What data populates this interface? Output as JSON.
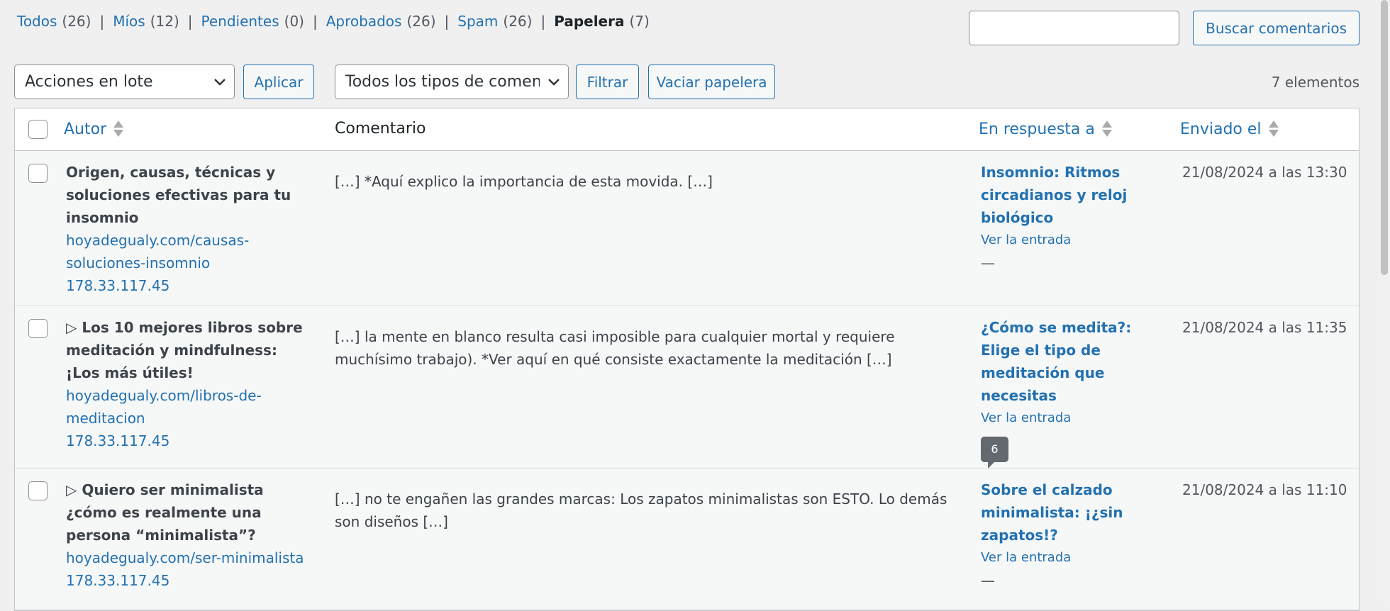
{
  "filters": [
    {
      "label": "Todos",
      "count": "(26)"
    },
    {
      "label": "Míos",
      "count": "(12)"
    },
    {
      "label": "Pendientes",
      "count": "(0)"
    },
    {
      "label": "Aprobados",
      "count": "(26)"
    },
    {
      "label": "Spam",
      "count": "(26)"
    },
    {
      "label": "Papelera",
      "count": "(7)"
    }
  ],
  "separator": "|",
  "search": {
    "value": "",
    "button": "Buscar comentarios"
  },
  "tablenav": {
    "bulk_actions": "Acciones en lote",
    "apply": "Aplicar",
    "comment_type": "Todos los tipos de comentarios",
    "filter": "Filtrar",
    "empty_trash": "Vaciar papelera",
    "count": "7 elementos"
  },
  "columns": {
    "author": "Autor",
    "comment": "Comentario",
    "response": "En respuesta a",
    "date": "Enviado el"
  },
  "rows": [
    {
      "author_name": "Origen, causas, técnicas y soluciones efectivas para tu insomnio",
      "author_url": "hoyadegualy.com/causas-soluciones-insomnio",
      "author_ip": "178.33.117.45",
      "comment": "[…] *Aquí explico la importancia de esta movida. […]",
      "response_post": "Insomnio: Ritmos circadianos y reloj biológico",
      "view": "Ver la entrada",
      "count": "—",
      "date": "21/08/2024 a las 13:30"
    },
    {
      "author_name": "▷ Los 10 mejores libros sobre meditación y mindfulness: ¡Los más útiles!",
      "author_url": "hoyadegualy.com/libros-de-meditacion",
      "author_ip": "178.33.117.45",
      "comment": "[…] la mente en blanco resulta casi imposible para cualquier mortal y requiere muchísimo trabajo). *Ver aquí en qué consiste exactamente la meditación […]",
      "response_post": "¿Cómo se medita?: Elige el tipo de meditación que necesitas",
      "view": "Ver la entrada",
      "count": "6",
      "date": "21/08/2024 a las 11:35"
    },
    {
      "author_name": "▷ Quiero ser minimalista ¿cómo es realmente una persona “minimalista”?",
      "author_url": "hoyadegualy.com/ser-minimalista",
      "author_ip": "178.33.117.45",
      "comment": "[…] no te engañen las grandes marcas: Los zapatos minimalistas son ESTO. Lo demás son diseños […]",
      "response_post": "Sobre el calzado minimalista: ¡¿sin zapatos!?",
      "view": "Ver la entrada",
      "count": "—",
      "date": "21/08/2024 a las 11:10"
    }
  ]
}
